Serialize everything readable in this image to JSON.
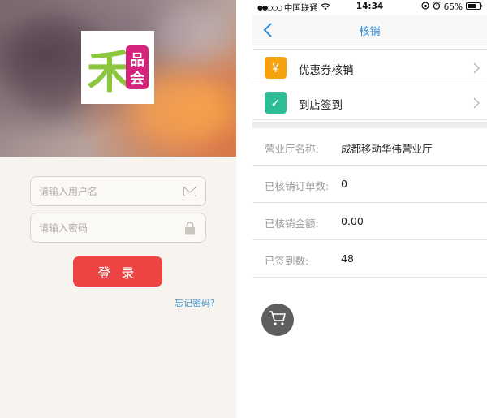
{
  "login": {
    "logo": {
      "char_main": "禾",
      "char_top": "品",
      "char_bottom": "会"
    },
    "username_placeholder": "请输入用户名",
    "password_placeholder": "请输入密码",
    "login_button": "登 录",
    "forgot_link": "忘记密码?"
  },
  "statusbar": {
    "carrier": "中国联通",
    "signal_dots": "●●○○○",
    "time": "14:34",
    "battery": "65%"
  },
  "navbar": {
    "title": "核销"
  },
  "menu": [
    {
      "icon": "yen-icon",
      "glyph": "¥",
      "color": "#f5a20c",
      "label": "优惠券核销"
    },
    {
      "icon": "check-icon",
      "glyph": "✓",
      "color": "#2dbd96",
      "label": "到店签到"
    }
  ],
  "info": [
    {
      "key": "营业厅名称:",
      "value": "成都移动华伟营业厅"
    },
    {
      "key": "已核销订单数:",
      "value": "0"
    },
    {
      "key": "已核销金额:",
      "value": "0.00"
    },
    {
      "key": "已签到数:",
      "value": "48"
    }
  ],
  "colors": {
    "accent_blue": "#2d8bd8",
    "login_red": "#ee4343",
    "logo_green": "#8cc63f",
    "logo_magenta": "#d4237a"
  }
}
